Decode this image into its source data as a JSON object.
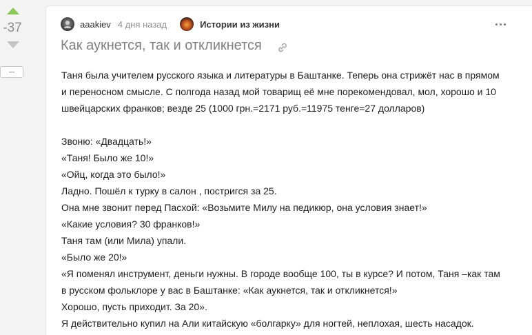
{
  "rating": {
    "value": "-37",
    "collapse_label": "–",
    "colors": {
      "up": "#8ac858",
      "down": "#c4c4c4"
    }
  },
  "post": {
    "author": "aaakiev",
    "time": "4 дня назад",
    "community": "Истории из жизни",
    "title": "Как аукнется, так и откликнется",
    "icons": {
      "avatar": "avatar-icon",
      "community": "community-icon",
      "more": "more-options-icon",
      "link": "link-icon"
    },
    "lines": [
      "Таня была учителем русского языка и литературы в Баштанке. Теперь она стрижёт нас в прямом",
      "и переносном смысле. С полгода назад мой товарищ её мне порекомендовал, мол, хорошо и 10",
      "швейцарских франков; везде 25 (1000 грн.=2171 руб.=11975 тенге=27 долларов)",
      "",
      "Звоню: «Двадцать!»",
      "«Таня!  Было же 10!»",
      "«Ойц, когда это было!»",
      "Ладно. Пошёл к турку в салон , постригся за 25.",
      "Она мне звонит перед Пасхой: «Возьмите Милу на педикюр, она условия знает!»",
      "«Какие условия?  30 франков!»",
      "Таня там (или Мила) упали.",
      "«Было же 20!»",
      "«Я поменял инструмент, деньги нужны. В городе вообще 100, ты в курсе? И потом, Таня –как там",
      "в русском фольклоре у вас в Баштанке: «Как аукнется, так и откликнется!»",
      "Хорошо, пусть приходит. За 20».",
      "Я действительно купил на Али китайскую «болгарку» для ногтей, неплохая, шесть насадок."
    ]
  }
}
